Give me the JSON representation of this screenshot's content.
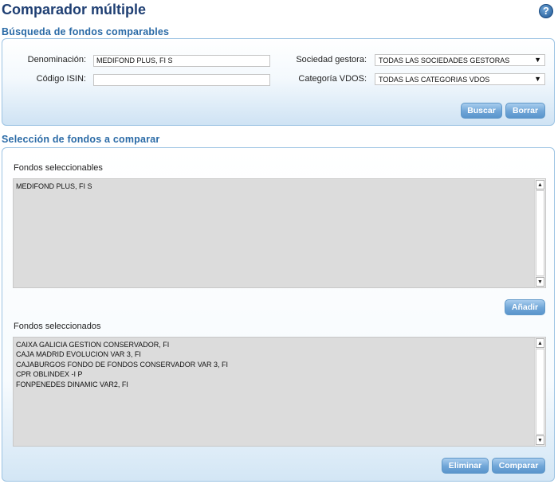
{
  "page": {
    "title": "Comparador múltiple"
  },
  "search": {
    "section_title": "Búsqueda de fondos comparables",
    "denominacion_label": "Denominación:",
    "denominacion_value": "MEDIFOND PLUS, FI S",
    "isin_label": "Código ISIN:",
    "isin_value": "",
    "gestora_label": "Sociedad gestora:",
    "gestora_value": "TODAS LAS SOCIEDADES GESTORAS",
    "categoria_label": "Categoría VDOS:",
    "categoria_value": "TODAS LAS CATEGORIAS VDOS",
    "buscar_label": "Buscar",
    "borrar_label": "Borrar"
  },
  "selection": {
    "section_title": "Selección de fondos a comparar",
    "selectable_label": "Fondos seleccionables",
    "selectable_items": [
      "MEDIFOND PLUS, FI S"
    ],
    "add_label": "Añadir",
    "selected_label": "Fondos seleccionados",
    "selected_items": [
      "CAIXA GALICIA GESTION CONSERVADOR, FI",
      "CAJA MADRID EVOLUCION VAR 3, FI",
      "CAJABURGOS FONDO DE FONDOS CONSERVADOR VAR 3, FI",
      "CPR OBLINDEX -I P",
      "FONPENEDES DINAMIC VAR2, FI"
    ],
    "remove_label": "Eliminar",
    "compare_label": "Comparar"
  },
  "icons": {
    "help": "help-icon",
    "scroll_up": "arrow-up-icon",
    "scroll_down": "arrow-down-icon",
    "dropdown": "chevron-down-icon"
  },
  "colors": {
    "title": "#1f3f73",
    "section_title": "#2a6aa6",
    "button": "#6fa5d7",
    "panel_border": "#9cc3e3",
    "listbox_bg": "#dcdcdc"
  }
}
